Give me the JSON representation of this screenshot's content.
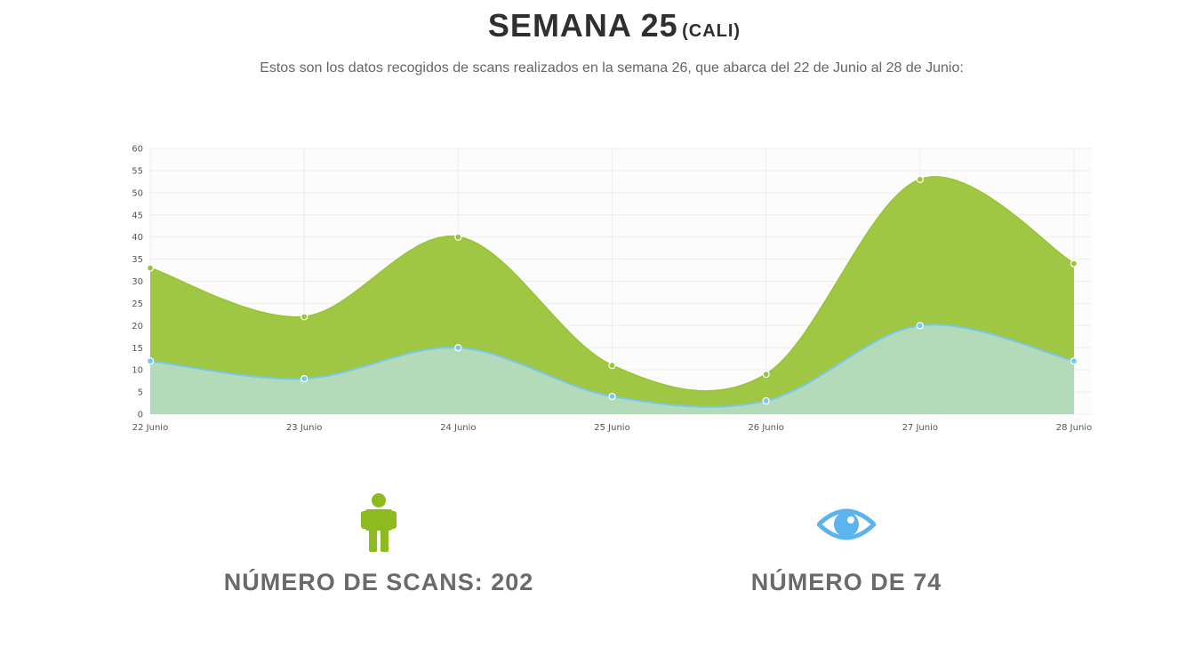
{
  "header": {
    "title": "SEMANA 25",
    "title_suffix": "(CALI)",
    "subtitle": "Estos son los datos recogidos de scans realizados en la semana 26, que abarca del 22 de Junio al 28 de Junio:"
  },
  "chart_data": {
    "type": "area",
    "categories": [
      "22 Junio",
      "23 Junio",
      "24 Junio",
      "25 Junio",
      "26 Junio",
      "27 Junio",
      "28 Junio"
    ],
    "series": [
      {
        "values": [
          33,
          22,
          40,
          11,
          9,
          53,
          34
        ],
        "color": "#9bc43a"
      },
      {
        "values": [
          12,
          8,
          15,
          4,
          3,
          20,
          12
        ],
        "color": "#b5dcc0",
        "line_color": "#79c7ee"
      }
    ],
    "ylim": [
      0,
      60
    ],
    "yticks": [
      0,
      5,
      10,
      15,
      20,
      25,
      30,
      35,
      40,
      45,
      50,
      55,
      60
    ],
    "grid": true
  },
  "stats": {
    "scans_label": "NÚMERO DE SCANS: 202",
    "views_label": "NÚMERO DE 74",
    "scans_icon": "person-icon",
    "views_icon": "eye-icon",
    "scans_color": "#8dbb1f",
    "views_color": "#5bb4ee"
  }
}
